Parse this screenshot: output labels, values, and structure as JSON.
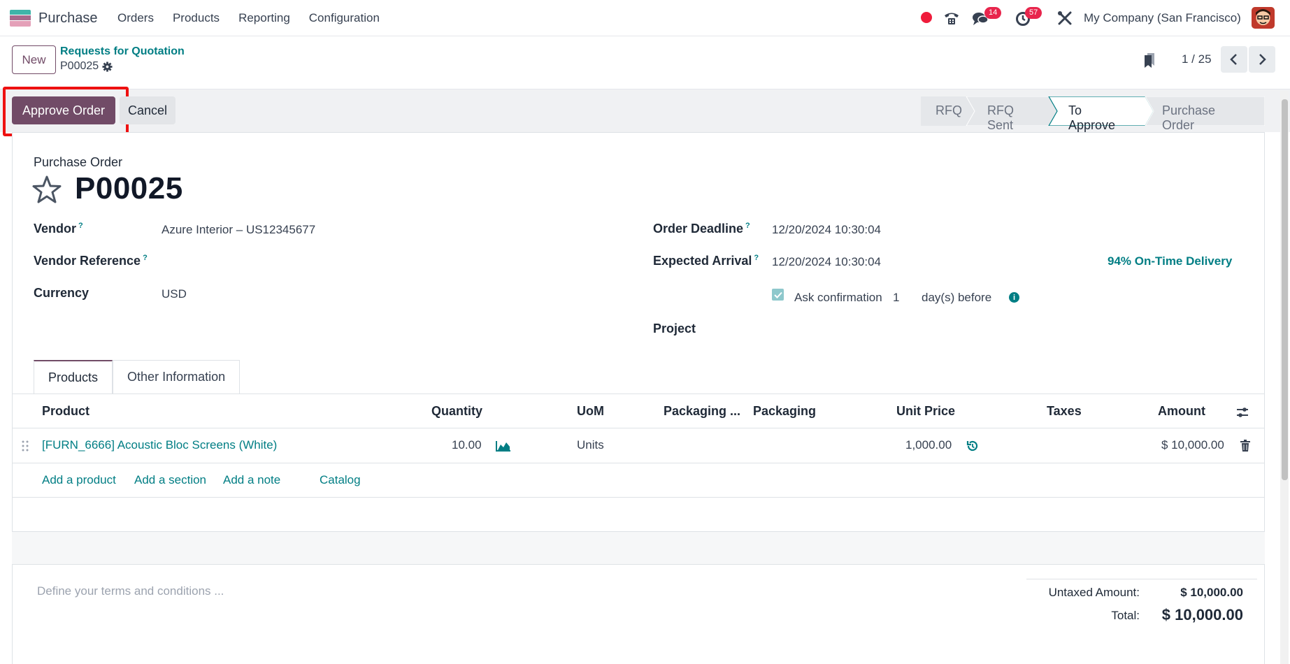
{
  "navbar": {
    "app_name": "Purchase",
    "menu": [
      "Orders",
      "Products",
      "Reporting",
      "Configuration"
    ],
    "messages_count": "14",
    "activities_count": "57",
    "company": "My Company (San Francisco)"
  },
  "control_panel": {
    "new_label": "New",
    "breadcrumb_parent": "Requests for Quotation",
    "breadcrumb_current": "P00025",
    "pager": "1 / 25"
  },
  "actions": {
    "approve_label": "Approve Order",
    "cancel_label": "Cancel"
  },
  "statusbar": {
    "stages": [
      "RFQ",
      "RFQ Sent",
      "To Approve",
      "Purchase Order"
    ],
    "active": "To Approve"
  },
  "form": {
    "doc_type": "Purchase Order",
    "name": "P00025",
    "vendor_label": "Vendor",
    "vendor_value": "Azure Interior – US12345677",
    "vendor_ref_label": "Vendor Reference",
    "currency_label": "Currency",
    "currency_value": "USD",
    "order_deadline_label": "Order Deadline",
    "order_deadline_value": "12/20/2024 10:30:04",
    "expected_arrival_label": "Expected Arrival",
    "expected_arrival_value": "12/20/2024 10:30:04",
    "on_time": "94% On-Time Delivery",
    "ask_confirmation_label": "Ask confirmation",
    "ask_confirmation_days": "1",
    "days_before": "day(s) before",
    "project_label": "Project",
    "help_mark": "?"
  },
  "tabs": [
    "Products",
    "Other Information"
  ],
  "table": {
    "headers": {
      "product": "Product",
      "quantity": "Quantity",
      "uom": "UoM",
      "packaging_qty": "Packaging ...",
      "packaging": "Packaging",
      "unit_price": "Unit Price",
      "taxes": "Taxes",
      "amount": "Amount"
    },
    "rows": [
      {
        "product": "[FURN_6666] Acoustic Bloc Screens (White)",
        "quantity": "10.00",
        "uom": "Units",
        "unit_price": "1,000.00",
        "amount": "$ 10,000.00"
      }
    ],
    "add_product": "Add a product",
    "add_section": "Add a section",
    "add_note": "Add a note",
    "catalog": "Catalog"
  },
  "footer": {
    "terms_placeholder": "Define your terms and conditions ...",
    "untaxed_label": "Untaxed Amount:",
    "untaxed_value": "$ 10,000.00",
    "total_label": "Total:",
    "total_value": "$ 10,000.00"
  }
}
